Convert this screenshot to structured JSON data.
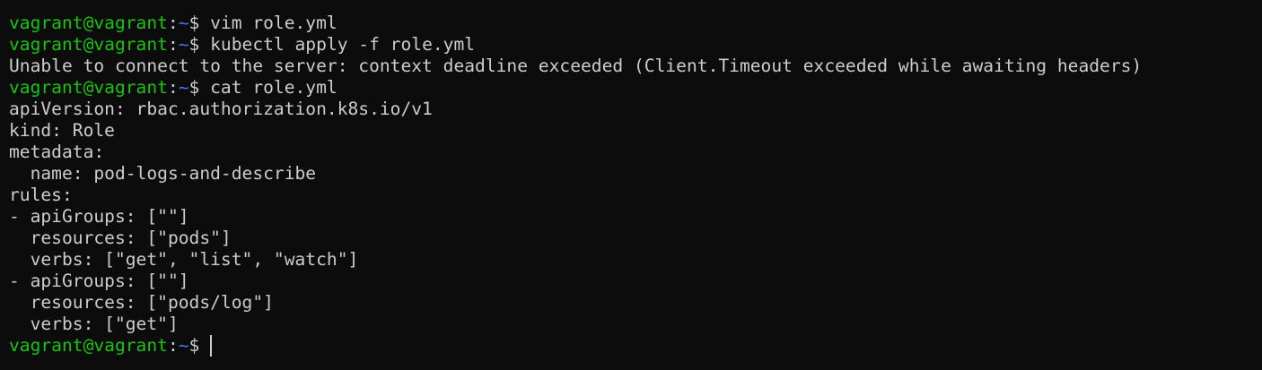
{
  "prompt": {
    "user_host": "vagrant@vagrant",
    "separator": ":",
    "path": "~",
    "symbol": "$ "
  },
  "commands": {
    "c1": "vim role.yml",
    "c2": "kubectl apply -f role.yml",
    "c3": "cat role.yml"
  },
  "output": {
    "error": "Unable to connect to the server: context deadline exceeded (Client.Timeout exceeded while awaiting headers)",
    "yaml": [
      "apiVersion: rbac.authorization.k8s.io/v1",
      "kind: Role",
      "metadata:",
      "  name: pod-logs-and-describe",
      "rules:",
      "- apiGroups: [\"\"]",
      "  resources: [\"pods\"]",
      "  verbs: [\"get\", \"list\", \"watch\"]",
      "- apiGroups: [\"\"]",
      "  resources: [\"pods/log\"]",
      "  verbs: [\"get\"]"
    ]
  },
  "colors": {
    "background": "#0c0c0c",
    "text": "#cccccc",
    "user_host": "#16c60c",
    "path": "#3b78ff"
  }
}
